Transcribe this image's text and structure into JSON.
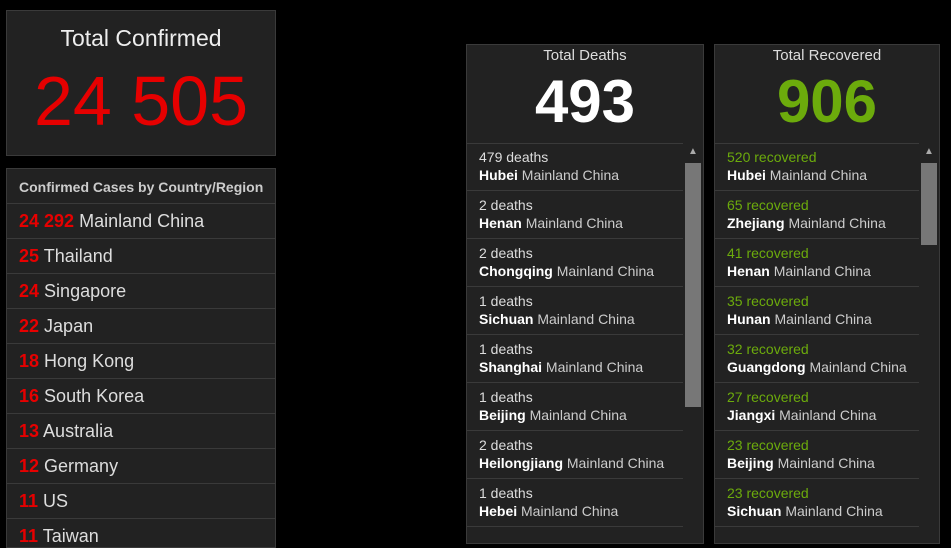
{
  "confirmed": {
    "title": "Total Confirmed",
    "count": "24 505"
  },
  "countries": {
    "header": "Confirmed Cases by Country/Region",
    "rows": [
      {
        "num": "24 292",
        "name": "Mainland China"
      },
      {
        "num": "25",
        "name": "Thailand"
      },
      {
        "num": "24",
        "name": "Singapore"
      },
      {
        "num": "22",
        "name": "Japan"
      },
      {
        "num": "18",
        "name": "Hong Kong"
      },
      {
        "num": "16",
        "name": "South Korea"
      },
      {
        "num": "13",
        "name": "Australia"
      },
      {
        "num": "12",
        "name": "Germany"
      },
      {
        "num": "11",
        "name": "US"
      },
      {
        "num": "11",
        "name": "Taiwan"
      }
    ]
  },
  "deaths": {
    "title": "Total Deaths",
    "count": "493",
    "rows": [
      {
        "metric": "479 deaths",
        "province": "Hubei",
        "region": "Mainland China"
      },
      {
        "metric": "2 deaths",
        "province": "Henan",
        "region": "Mainland China"
      },
      {
        "metric": "2 deaths",
        "province": "Chongqing",
        "region": "Mainland China"
      },
      {
        "metric": "1 deaths",
        "province": "Sichuan",
        "region": "Mainland China"
      },
      {
        "metric": "1 deaths",
        "province": "Shanghai",
        "region": "Mainland China"
      },
      {
        "metric": "1 deaths",
        "province": "Beijing",
        "region": "Mainland China"
      },
      {
        "metric": "2 deaths",
        "province": "Heilongjiang",
        "region": "Mainland China"
      },
      {
        "metric": "1 deaths",
        "province": "Hebei",
        "region": "Mainland China"
      }
    ]
  },
  "recovered": {
    "title": "Total Recovered",
    "count": "906",
    "rows": [
      {
        "metric": "520 recovered",
        "province": "Hubei",
        "region": "Mainland China"
      },
      {
        "metric": "65 recovered",
        "province": "Zhejiang",
        "region": "Mainland China"
      },
      {
        "metric": "41 recovered",
        "province": "Henan",
        "region": "Mainland China"
      },
      {
        "metric": "35 recovered",
        "province": "Hunan",
        "region": "Mainland China"
      },
      {
        "metric": "32 recovered",
        "province": "Guangdong",
        "region": "Mainland China"
      },
      {
        "metric": "27 recovered",
        "province": "Jiangxi",
        "region": "Mainland China"
      },
      {
        "metric": "23 recovered",
        "province": "Beijing",
        "region": "Mainland China"
      },
      {
        "metric": "23 recovered",
        "province": "Sichuan",
        "region": "Mainland China"
      }
    ]
  }
}
